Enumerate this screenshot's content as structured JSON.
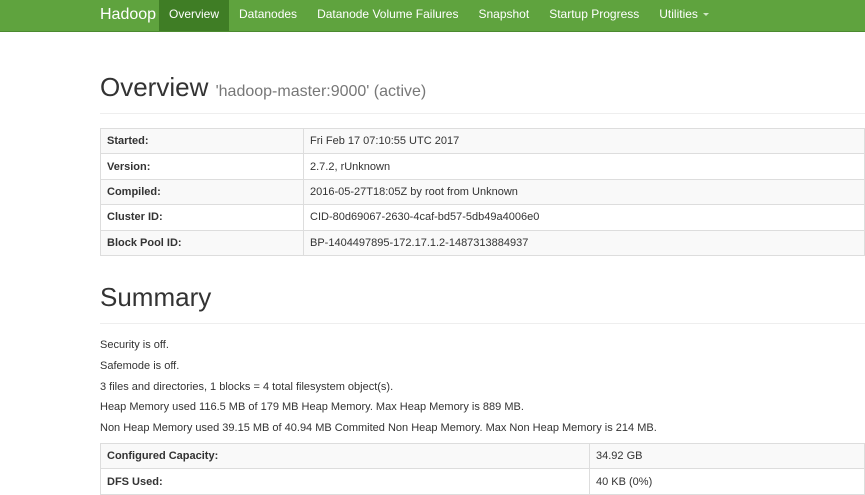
{
  "navbar": {
    "brand": "Hadoop",
    "items": [
      {
        "label": "Overview"
      },
      {
        "label": "Datanodes"
      },
      {
        "label": "Datanode Volume Failures"
      },
      {
        "label": "Snapshot"
      },
      {
        "label": "Startup Progress"
      },
      {
        "label": "Utilities"
      }
    ],
    "active_item": "Overview",
    "colors": {
      "background": "#5fa33e",
      "active": "#3f7d25"
    }
  },
  "overview": {
    "title": "Overview",
    "subtitle": "'hadoop-master:9000' (active)",
    "rows": [
      {
        "key": "Started:",
        "value": "Fri Feb 17 07:10:55 UTC 2017"
      },
      {
        "key": "Version:",
        "value": "2.7.2, rUnknown"
      },
      {
        "key": "Compiled:",
        "value": "2016-05-27T18:05Z by root from Unknown"
      },
      {
        "key": "Cluster ID:",
        "value": "CID-80d69067-2630-4caf-bd57-5db49a4006e0"
      },
      {
        "key": "Block Pool ID:",
        "value": "BP-1404497895-172.17.1.2-1487313884937"
      }
    ]
  },
  "summary": {
    "title": "Summary",
    "lines": [
      "Security is off.",
      "Safemode is off.",
      "3 files and directories, 1 blocks = 4 total filesystem object(s).",
      "Heap Memory used 116.5 MB of 179 MB Heap Memory. Max Heap Memory is 889 MB.",
      "Non Heap Memory used 39.15 MB of 40.94 MB Commited Non Heap Memory. Max Non Heap Memory is 214 MB."
    ],
    "rows": [
      {
        "key": "Configured Capacity:",
        "value": "34.92 GB"
      },
      {
        "key": "DFS Used:",
        "value": "40 KB (0%)"
      }
    ]
  }
}
